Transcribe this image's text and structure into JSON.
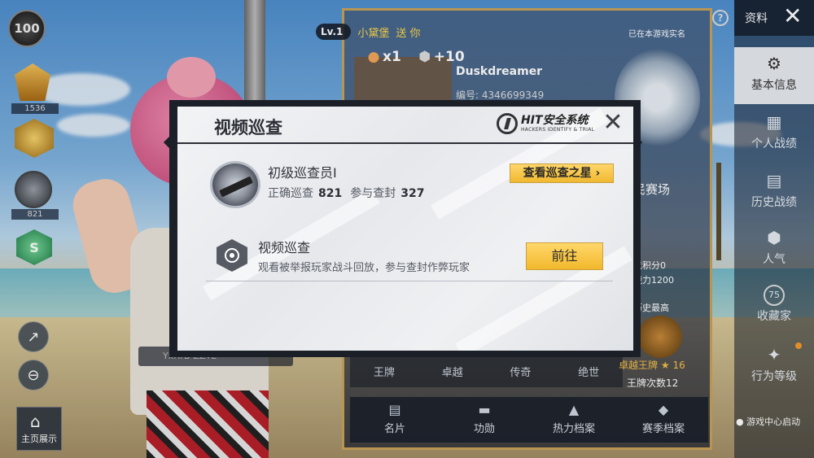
{
  "top_bar": {
    "level_label": "Lv.1",
    "gift_sender": "小黛堡",
    "gift_verb": "送 你",
    "reward1_icon": "drumstick-icon",
    "reward1_value": "x1",
    "reward2_icon": "gem-icon",
    "reward2_value": "+10"
  },
  "left_col": {
    "rank_badge1_value": "100",
    "rank_badge2_caption": "1536",
    "rank_badge4_caption": "821",
    "home_button_label": "主页展示",
    "name_chip_text": "YxHrB-ZZYL"
  },
  "profile": {
    "player_name": "Duskdreamer",
    "player_id": "编号: 4346699349",
    "realname_status": "已在本游戏实名",
    "arena_label": "民赛场",
    "score_label": "竞积分0",
    "power_label": "战力1200",
    "history_best_label": "历史最高",
    "tiers": [
      "王牌",
      "卓越",
      "传奇",
      "绝世"
    ],
    "ace_label": "卓越王牌",
    "ace_star_count": "16",
    "ace_times_label": "王牌次数12",
    "bottom_tabs": [
      {
        "icon": "id-card-icon",
        "label": "名片"
      },
      {
        "icon": "medal-icon",
        "label": "功勋"
      },
      {
        "icon": "flame-icon",
        "label": "热力档案"
      },
      {
        "icon": "trophy-icon",
        "label": "赛季档案"
      }
    ]
  },
  "right_sidebar": {
    "top_label": "资料",
    "items": [
      {
        "icon": "profile-icon",
        "label": "基本信息"
      },
      {
        "icon": "stats-icon",
        "label": "个人战绩"
      },
      {
        "icon": "history-icon",
        "label": "历史战绩"
      },
      {
        "icon": "popularity-icon",
        "label": "人气"
      },
      {
        "icon": "collection-icon",
        "label": "收藏家"
      },
      {
        "icon": "behavior-icon",
        "label": "行为等级"
      }
    ],
    "collection_badge": "75",
    "game_center_label": "游戏中心启动"
  },
  "modal": {
    "title": "视频巡查",
    "logo_text": "HIT安全系统",
    "logo_subtext": "HACKERS IDENTIFY & TRIAL",
    "rank_title": "初级巡查员I",
    "correct_label": "正确巡查",
    "correct_value": "821",
    "ban_label": "参与查封",
    "ban_value": "327",
    "star_button_label": "查看巡查之星",
    "task_title": "视频巡查",
    "task_desc": "观看被举报玩家战斗回放，参与查封作弊玩家",
    "go_button_label": "前往"
  },
  "colors": {
    "accent_gold": "#f2b82c",
    "modal_bg": "#eceef1",
    "frame_gold": "#c8a35a"
  }
}
